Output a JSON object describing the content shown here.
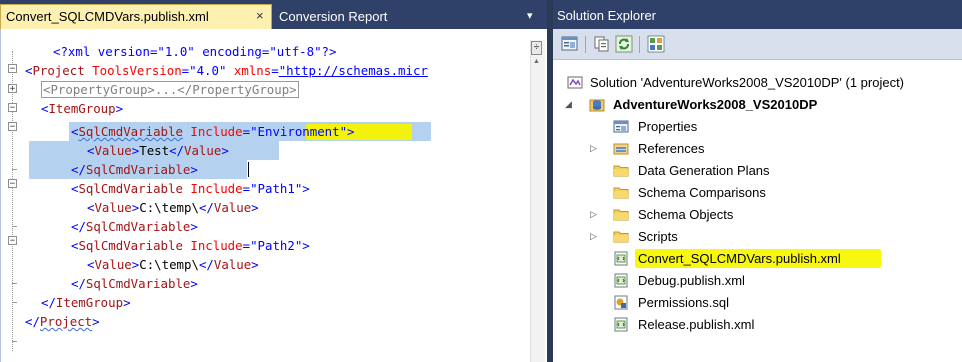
{
  "editor": {
    "tabs": [
      {
        "label": "Convert_SQLCMDVars.publish.xml",
        "close": "×"
      },
      {
        "label": "Conversion Report"
      }
    ],
    "dropdown_glyph": "▾",
    "split_glyph": "÷",
    "code": {
      "l1": {
        "decl": "<?xml version=\"1.0\" encoding=\"utf-8\"?>"
      },
      "l2": {
        "lt": "<",
        "tag": "Project",
        "attr": " ToolsVersion",
        "eq": "=",
        "val": "\"4.0\"",
        "attr2": " xmlns",
        "eq2": "=",
        "link": "\"http://schemas.micr"
      },
      "l3": {
        "collapsed": "<PropertyGroup>...</PropertyGroup>"
      },
      "l4": {
        "lt": "<",
        "tag": "ItemGroup",
        "gt": ">"
      },
      "l5": {
        "lt": "<",
        "tag": "SqlCmdVariable",
        "attr": " Include",
        "eq": "=",
        "val": "\"Environment\"",
        "gt": ">"
      },
      "l6": {
        "lt": "<",
        "tag": "Value",
        "gt": ">",
        "text": "Test",
        "lt2": "</",
        "tag2": "Value",
        "gt2": ">"
      },
      "l7": {
        "lt": "</",
        "tag": "SqlCmdVariable",
        "gt": ">"
      },
      "l8": {
        "lt": "<",
        "tag": "SqlCmdVariable",
        "attr": " Include",
        "eq": "=",
        "val": "\"Path1\"",
        "gt": ">"
      },
      "l9": {
        "lt": "<",
        "tag": "Value",
        "gt": ">",
        "text": "C:\\temp\\",
        "lt2": "</",
        "tag2": "Value",
        "gt2": ">"
      },
      "l10": {
        "lt": "</",
        "tag": "SqlCmdVariable",
        "gt": ">"
      },
      "l11": {
        "lt": "<",
        "tag": "SqlCmdVariable",
        "attr": " Include",
        "eq": "=",
        "val": "\"Path2\"",
        "gt": ">"
      },
      "l12": {
        "lt": "<",
        "tag": "Value",
        "gt": ">",
        "text": "C:\\temp\\",
        "lt2": "</",
        "tag2": "Value",
        "gt2": ">"
      },
      "l13": {
        "lt": "</",
        "tag": "SqlCmdVariable",
        "gt": ">"
      },
      "l14": {
        "lt": "</",
        "tag": "ItemGroup",
        "gt": ">"
      },
      "l15": {
        "lt": "</",
        "tag": "Project",
        "gt": ">"
      }
    },
    "fold_glyphs": {
      "expanded": "−",
      "collapsed": "+"
    }
  },
  "solution_explorer": {
    "title": "Solution Explorer",
    "toolbar_icons": [
      "properties-icon",
      "show-all-files-icon",
      "refresh-icon",
      "view-class-diagram-icon"
    ],
    "items": [
      {
        "label": "Solution 'AdventureWorks2008_VS2010DP' (1 project)",
        "icon": "solution-icon"
      },
      {
        "label": "AdventureWorks2008_VS2010DP",
        "icon": "database-project-icon",
        "expander": "◢"
      },
      {
        "label": "Properties",
        "icon": "properties-icon"
      },
      {
        "label": "References",
        "icon": "references-icon",
        "expander": "▷"
      },
      {
        "label": "Data Generation Plans",
        "icon": "folder-icon"
      },
      {
        "label": "Schema Comparisons",
        "icon": "folder-icon"
      },
      {
        "label": "Schema Objects",
        "icon": "folder-icon",
        "expander": "▷"
      },
      {
        "label": "Scripts",
        "icon": "folder-icon",
        "expander": "▷"
      },
      {
        "label": "Convert_SQLCMDVars.publish.xml",
        "icon": "xml-file-icon"
      },
      {
        "label": "Debug.publish.xml",
        "icon": "xml-file-icon"
      },
      {
        "label": "Permissions.sql",
        "icon": "sql-file-icon"
      },
      {
        "label": "Release.publish.xml",
        "icon": "xml-file-icon"
      }
    ]
  },
  "colors": {
    "title_bar": "#2f4069",
    "active_tab": "#fdf0b0",
    "selection": "#b4d2f0",
    "highlight": "#f2f20a",
    "xml_tag": "#a31515",
    "xml_attr": "#ff0000",
    "xml_punct": "#0000ff"
  }
}
